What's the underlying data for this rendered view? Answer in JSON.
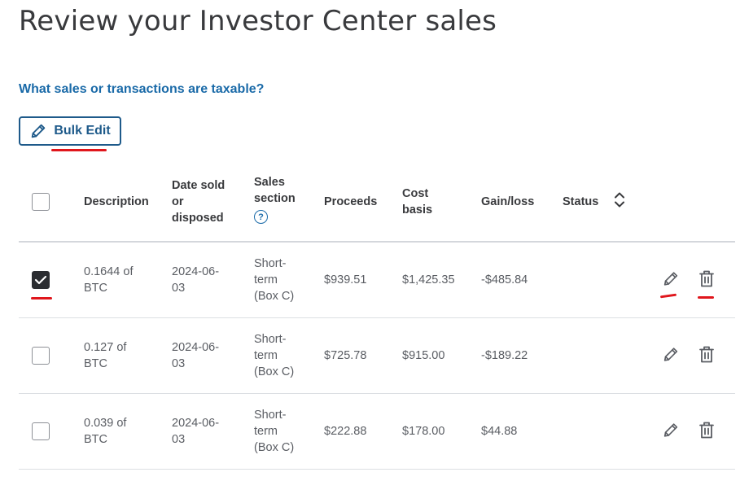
{
  "page": {
    "title": "Review your Investor Center sales",
    "help_link": "What sales or transactions are taxable?",
    "bulk_edit_label": "Bulk Edit"
  },
  "table": {
    "headers": {
      "description": "Description",
      "date_l1": "Date sold",
      "date_l2": "or",
      "date_l3": "disposed",
      "sales_l1": "Sales",
      "sales_l2": "section",
      "proceeds": "Proceeds",
      "cost_l1": "Cost",
      "cost_l2": "basis",
      "gain_loss": "Gain/loss",
      "status": "Status"
    },
    "rows": [
      {
        "checked": true,
        "description_l1": "0.1644 of",
        "description_l2": "BTC",
        "date_l1": "2024-06-",
        "date_l2": "03",
        "section_l1": "Short-",
        "section_l2": "term",
        "section_l3": "(Box C)",
        "proceeds": "$939.51",
        "cost_basis": "$1,425.35",
        "gain_loss": "-$485.84",
        "status": ""
      },
      {
        "checked": false,
        "description_l1": "0.127 of",
        "description_l2": "BTC",
        "date_l1": "2024-06-",
        "date_l2": "03",
        "section_l1": "Short-",
        "section_l2": "term",
        "section_l3": "(Box C)",
        "proceeds": "$725.78",
        "cost_basis": "$915.00",
        "gain_loss": "-$189.22",
        "status": ""
      },
      {
        "checked": false,
        "description_l1": "0.039 of",
        "description_l2": "BTC",
        "date_l1": "2024-06-",
        "date_l2": "03",
        "section_l1": "Short-",
        "section_l2": "term",
        "section_l3": "(Box C)",
        "proceeds": "$222.88",
        "cost_basis": "$178.00",
        "gain_loss": "$44.88",
        "status": ""
      }
    ]
  },
  "icons": {
    "bulk_edit": "pencil-icon",
    "help": "question-circle-icon",
    "sort": "sort-chevrons-icon",
    "row_edit": "pencil-icon",
    "row_delete": "trash-icon",
    "checkbox_checked": "checkmark-icon"
  },
  "colors": {
    "link": "#1a6aa8",
    "button": "#1e5a8a",
    "annotation": "#e0161c",
    "checkbox_checked": "#2b2d31"
  }
}
